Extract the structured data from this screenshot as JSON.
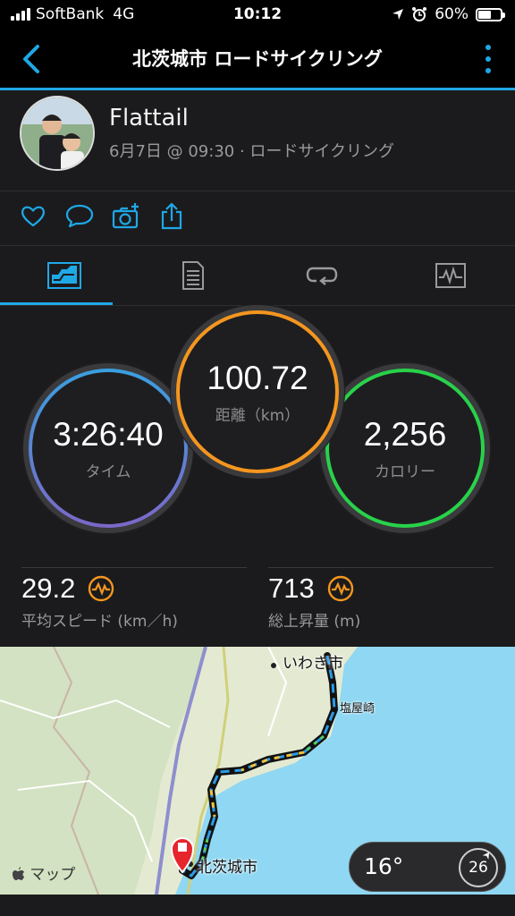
{
  "status_bar": {
    "carrier": "SoftBank",
    "network": "4G",
    "time": "10:12",
    "battery": "60%",
    "battery_level": 0.6
  },
  "nav": {
    "title": "北茨城市 ロードサイクリング"
  },
  "profile": {
    "name": "Flattail",
    "meta": "6月7日 @ 09:30 · ロードサイクリング"
  },
  "actions": [
    "heart-icon",
    "comment-icon",
    "camera-plus-icon",
    "share-icon"
  ],
  "tabs": [
    {
      "icon": "summary-chart-icon",
      "active": true
    },
    {
      "icon": "details-list-icon",
      "active": false
    },
    {
      "icon": "laps-icon",
      "active": false
    },
    {
      "icon": "graph-icon",
      "active": false
    }
  ],
  "stats": {
    "time": {
      "value": "3:26:40",
      "label": "タイム"
    },
    "distance": {
      "value": "100.72",
      "label": "距離（km）"
    },
    "calories": {
      "value": "2,256",
      "label": "カロリー"
    },
    "avg_speed": {
      "value": "29.2",
      "label": "平均スピード (km／h)"
    },
    "elevation": {
      "value": "713",
      "label": "総上昇量 (m)"
    }
  },
  "colors": {
    "accent": "#1fa8e6",
    "orange": "#f5961f",
    "green": "#28d24a",
    "blue": "#3a9fe0",
    "purple": "#7b68c8"
  },
  "map": {
    "place_iwaki": "いわき市",
    "place_shioyazaki": "塩屋崎",
    "place_kitaibaraki": "北茨城市",
    "maps_label": "マップ",
    "temperature": "16°",
    "wind": "26"
  }
}
